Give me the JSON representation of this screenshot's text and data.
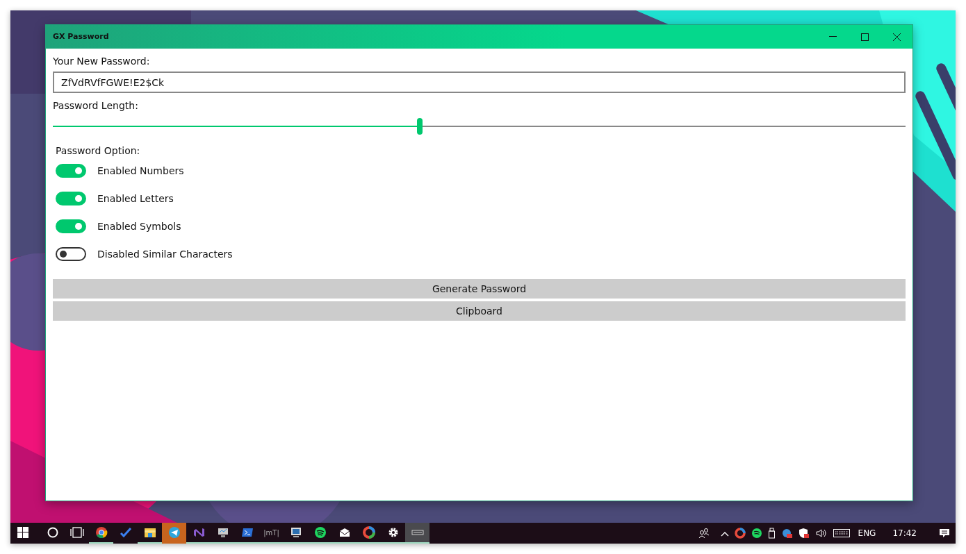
{
  "window": {
    "title": "GX Password"
  },
  "password": {
    "label": "Your New Password:",
    "value": "ZfVdRVfFGWE!E2$Ck"
  },
  "length": {
    "label": "Password Length:",
    "level": 0.43
  },
  "options": {
    "label": "Password Option:",
    "toggles": [
      {
        "label": "Enabled Numbers",
        "on": true
      },
      {
        "label": "Enabled Letters",
        "on": true
      },
      {
        "label": "Enabled Symbols",
        "on": true
      },
      {
        "label": "Disabled Similar Characters",
        "on": false
      }
    ]
  },
  "buttons": [
    "Generate Password",
    "Clipboard"
  ],
  "taskbar": {
    "apps": [
      {
        "running": true,
        "selected": false,
        "attention": false
      },
      {
        "running": false,
        "selected": false,
        "attention": false
      },
      {
        "running": true,
        "selected": false,
        "attention": false
      },
      {
        "running": false,
        "selected": false,
        "attention": true
      },
      {
        "running": true,
        "selected": false,
        "attention": false
      },
      {
        "running": true,
        "selected": false,
        "attention": false
      },
      {
        "running": true,
        "selected": false,
        "attention": false
      },
      {
        "running": true,
        "selected": false,
        "attention": false,
        "text": "|mT|"
      },
      {
        "running": true,
        "selected": false,
        "attention": false
      },
      {
        "running": true,
        "selected": false,
        "attention": false
      },
      {
        "running": true,
        "selected": false,
        "attention": false
      },
      {
        "running": true,
        "selected": false,
        "attention": false
      },
      {
        "running": true,
        "selected": false,
        "attention": false
      },
      {
        "running": true,
        "selected": true,
        "attention": false
      }
    ],
    "language": "ENG",
    "time": "17:42"
  }
}
